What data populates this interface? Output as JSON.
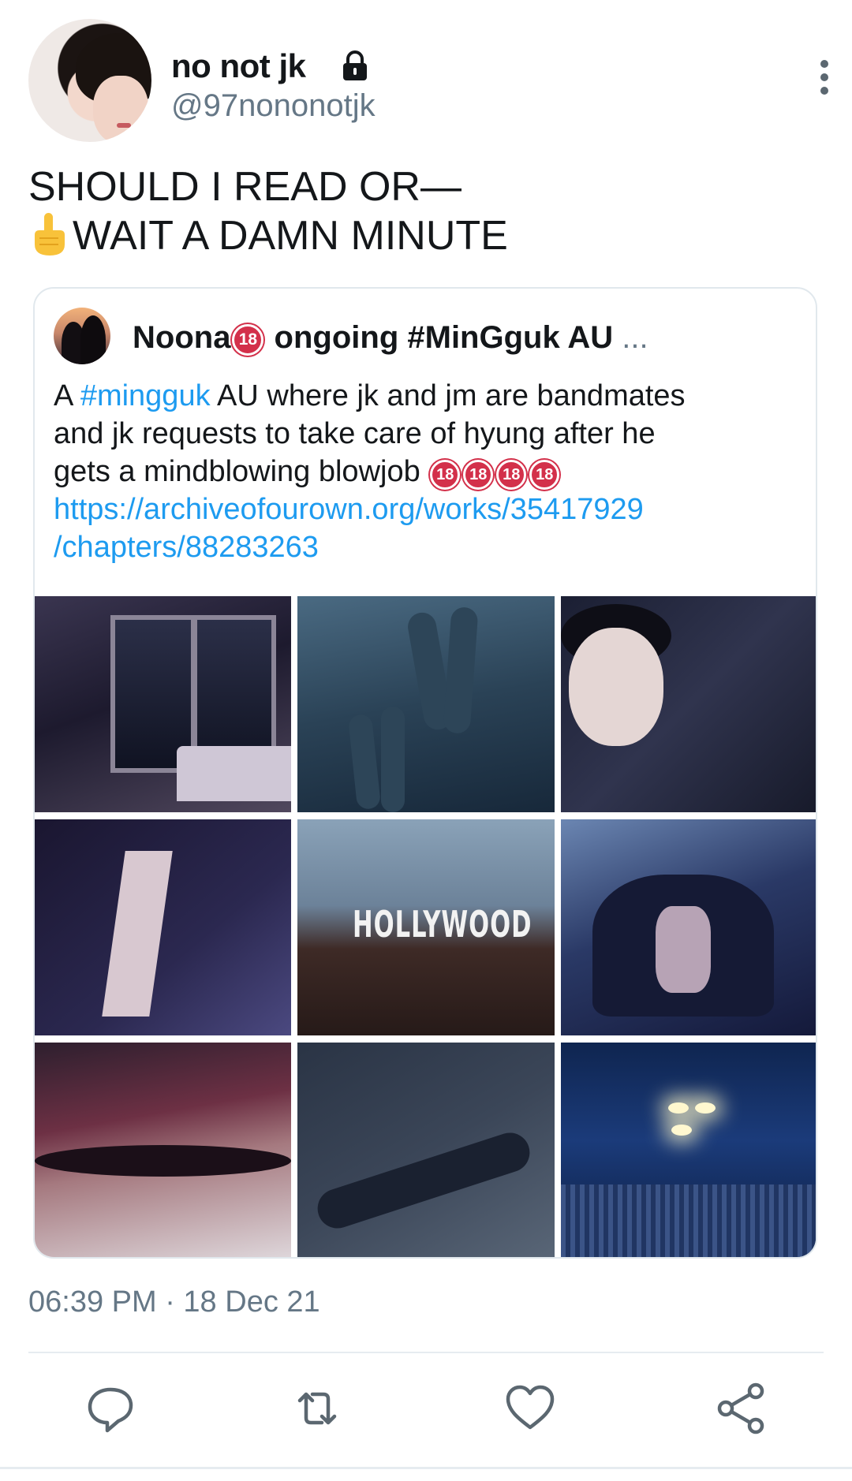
{
  "author": {
    "display_name": "no not jk",
    "handle": "@97nononotjk",
    "protected_icon": "lock-icon"
  },
  "tweet": {
    "line1": "SHOULD I READ OR—",
    "line2": "WAIT A DAMN MINUTE",
    "emoji_icon": "pointing-up-finger-icon",
    "timestamp": "06:39 PM · 18 Dec 21"
  },
  "quoted": {
    "name": "Noona",
    "name_rest": " ongoing #MinGguk AU",
    "ellipsis": "...",
    "badge": "18",
    "body_prefix": "A ",
    "hashtag": "#mingguk",
    "body_line1_rest": " AU where jk and jm are bandmates",
    "body_line2": "and jk requests to take care of hyung after he",
    "body_line3": "gets a mindblowing blowjob ",
    "link_line1": "https://archiveofourown.org/works/35417929",
    "link_line2": "/chapters/88283263",
    "image_sign_text": "HOLLYWOOD"
  },
  "actions": {
    "reply_icon": "reply-icon",
    "retweet_icon": "retweet-icon",
    "like_icon": "heart-icon",
    "share_icon": "share-icon"
  },
  "colors": {
    "link": "#1d9bf0",
    "secondary_text": "#657786",
    "badge": "#d3304a"
  }
}
